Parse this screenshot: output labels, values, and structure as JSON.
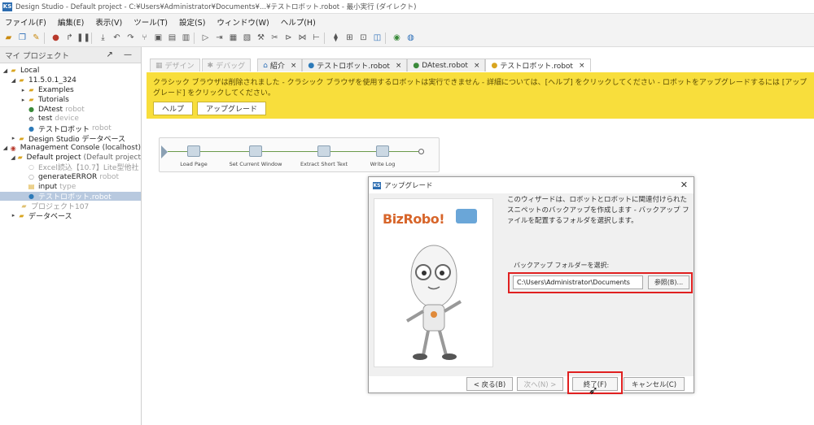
{
  "window": {
    "title": "Design Studio - Default project - C:¥Users¥Administrator¥Documents¥...¥テストロボット.robot - 最小実行 (ダイレクト)"
  },
  "menubar": [
    "ファイル(F)",
    "編集(E)",
    "表示(V)",
    "ツール(T)",
    "設定(S)",
    "ウィンドウ(W)",
    "ヘルプ(H)"
  ],
  "left_panel": {
    "title": "マイ プロジェクト",
    "tree": [
      {
        "label": "Local",
        "sub": ""
      },
      {
        "label": "11.5.0.1_324",
        "sub": ""
      },
      {
        "label": "Examples",
        "sub": ""
      },
      {
        "label": "Tutorials",
        "sub": ""
      },
      {
        "label": "DAtest",
        "sub": "robot"
      },
      {
        "label": "test",
        "sub": "device"
      },
      {
        "label": "テストロボット",
        "sub": "robot"
      },
      {
        "label": "Design Studio データベース",
        "sub": ""
      },
      {
        "label": "Management Console",
        "sub": "(localhost)"
      },
      {
        "label": "Default project",
        "sub": "(Default project"
      },
      {
        "label": "Excel読込【10.7】Lite型他社",
        "sub": ""
      },
      {
        "label": "generateERROR",
        "sub": "robot"
      },
      {
        "label": "input",
        "sub": "type"
      },
      {
        "label": "テストロボット.robot",
        "sub": ""
      },
      {
        "label": "プロジェクト107",
        "sub": ""
      },
      {
        "label": "データベース",
        "sub": ""
      }
    ]
  },
  "editor": {
    "mode_tabs": [
      "デザイン",
      "デバッグ"
    ],
    "tabs": [
      "紹介",
      "テストロボット.robot",
      "DAtest.robot",
      "テストロボット.robot"
    ],
    "warning": {
      "text": "クラシック ブラウザは削除されました - クラシック ブラウザを使用するロボットは実行できません - 詳細については、[ヘルプ] をクリックしてください - ロボットをアップグレードするには [アップグレード] をクリックしてください。",
      "help_label": "ヘルプ",
      "upgrade_label": "アップグレード"
    },
    "flow_steps": [
      "Load Page",
      "Set Current Window",
      "Extract Short Text",
      "Write Log"
    ]
  },
  "dialog": {
    "title": "アップグレード",
    "brand": "BizRobo!",
    "description": "このウィザードは、ロボットとロボットに関連付けられたスニペットのバックアップを作成します - バックアップ ファイルを配置するフォルダを選択します。",
    "folder_label": "バックアップ フォルダーを選択:",
    "folder_value": "C:\\Users\\Administrator\\Documents",
    "browse_label": "参照(B)...",
    "back_label": "< 戻る(B)",
    "next_label": "次へ(N) >",
    "finish_label": "終了(F)",
    "cancel_label": "キャンセル(C)"
  },
  "colors": {
    "warning_bg": "#f8de3c",
    "highlight": "#e02020",
    "selection": "#b8c9df"
  }
}
